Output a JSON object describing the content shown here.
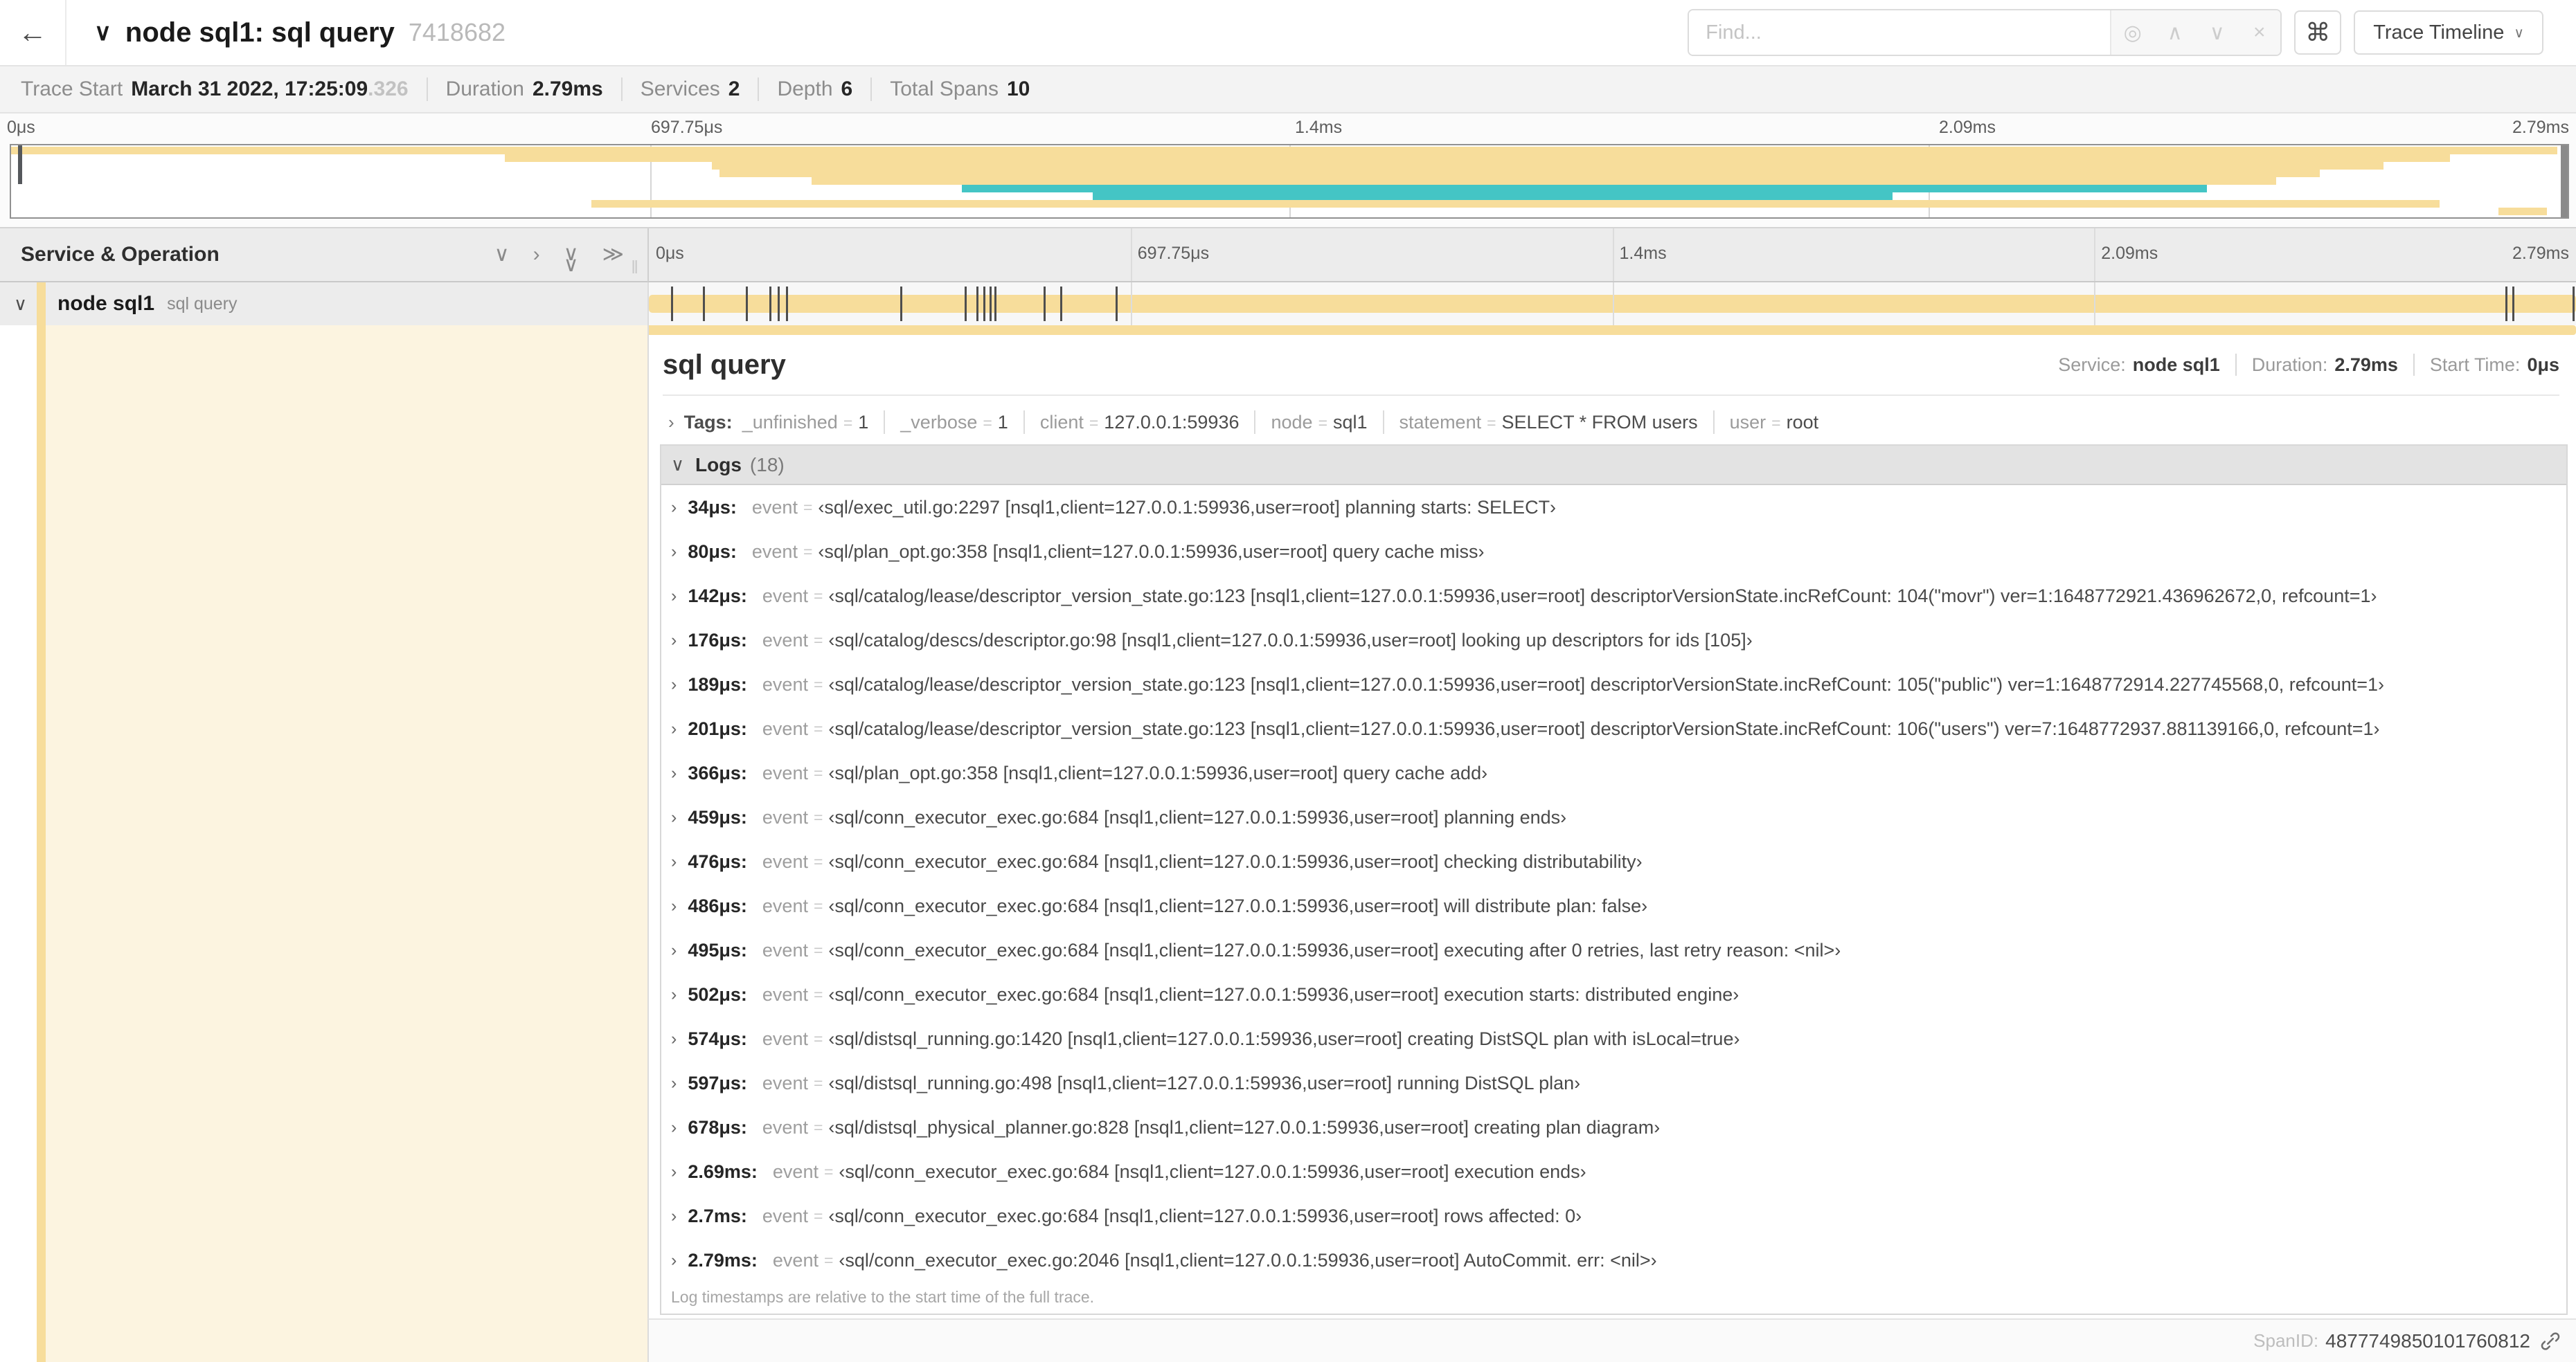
{
  "header": {
    "back_icon": "←",
    "collapse_icon": "∨",
    "title": "node sql1: sql query",
    "trace_id": "7418682",
    "find_placeholder": "Find...",
    "find_buttons": [
      "target-icon",
      "chevron-up-icon",
      "chevron-down-icon",
      "clear-icon"
    ],
    "shortcut_icon": "⌘",
    "view_selector": "Trace Timeline"
  },
  "summary": {
    "items": [
      {
        "label": "Trace Start",
        "value": "March 31 2022, 17:25:09",
        "suffix": ".326"
      },
      {
        "label": "Duration",
        "value": "2.79ms"
      },
      {
        "label": "Services",
        "value": "2"
      },
      {
        "label": "Depth",
        "value": "6"
      },
      {
        "label": "Total Spans",
        "value": "10"
      }
    ]
  },
  "time_ticks": [
    "0μs",
    "697.75μs",
    "1.4ms",
    "2.09ms",
    "2.79ms"
  ],
  "minimap": {
    "rows": [
      {
        "color": "#F7DD9B",
        "start": 0,
        "end": 99.6
      },
      {
        "color": "#F7DD9B",
        "start": 19.3,
        "end": 95.4
      },
      {
        "color": "#F7DD9B",
        "start": 27.4,
        "end": 92.8
      },
      {
        "color": "#F7DD9B",
        "start": 27.7,
        "end": 90.3
      },
      {
        "color": "#F7DD9B",
        "start": 31.3,
        "end": 88.6
      },
      {
        "color": "#44C5C5",
        "start": 37.2,
        "end": 85.9
      },
      {
        "color": "#44C5C5",
        "start": 42.3,
        "end": 73.6
      },
      {
        "color": "#F7DD9B",
        "start": 22.7,
        "end": 95.0
      },
      {
        "color": "#F7DD9B",
        "start": 97.3,
        "end": 99.2
      }
    ]
  },
  "colors": {
    "span": "#F7DD9B",
    "span_alt": "#44C5C5"
  },
  "grid": {
    "left_title": "Service & Operation"
  },
  "span_row": {
    "expand_icon": "∨",
    "service": "node sql1",
    "operation": "sql query"
  },
  "detail": {
    "title": "sql query",
    "meta": [
      {
        "label": "Service:",
        "value": "node sql1"
      },
      {
        "label": "Duration:",
        "value": "2.79ms"
      },
      {
        "label": "Start Time:",
        "value": "0μs"
      }
    ],
    "tags": {
      "label": "Tags:",
      "items": [
        {
          "key": "_unfinished",
          "value": "1"
        },
        {
          "key": "_verbose",
          "value": "1"
        },
        {
          "key": "client",
          "value": "127.0.0.1:59936"
        },
        {
          "key": "node",
          "value": "sql1"
        },
        {
          "key": "statement",
          "value": "SELECT * FROM users"
        },
        {
          "key": "user",
          "value": "root"
        }
      ]
    },
    "logs": {
      "title": "Logs",
      "count": "(18)",
      "field": "event",
      "entries": [
        {
          "time": "34μs:",
          "pct": 1.22,
          "value": "‹sql/exec_util.go:2297 [nsql1,client=127.0.0.1:59936,user=root] planning starts: SELECT›"
        },
        {
          "time": "80μs:",
          "pct": 2.87,
          "value": "‹sql/plan_opt.go:358 [nsql1,client=127.0.0.1:59936,user=root] query cache miss›"
        },
        {
          "time": "142μs:",
          "pct": 5.09,
          "value": "‹sql/catalog/lease/descriptor_version_state.go:123 [nsql1,client=127.0.0.1:59936,user=root] descriptorVersionState.incRefCount: 104(\"movr\") ver=1:1648772921.436962672,0, refcount=1›"
        },
        {
          "time": "176μs:",
          "pct": 6.31,
          "value": "‹sql/catalog/descs/descriptor.go:98 [nsql1,client=127.0.0.1:59936,user=root] looking up descriptors for ids [105]›"
        },
        {
          "time": "189μs:",
          "pct": 6.77,
          "value": "‹sql/catalog/lease/descriptor_version_state.go:123 [nsql1,client=127.0.0.1:59936,user=root] descriptorVersionState.incRefCount: 105(\"public\") ver=1:1648772914.227745568,0, refcount=1›"
        },
        {
          "time": "201μs:",
          "pct": 7.2,
          "value": "‹sql/catalog/lease/descriptor_version_state.go:123 [nsql1,client=127.0.0.1:59936,user=root] descriptorVersionState.incRefCount: 106(\"users\") ver=7:1648772937.881139166,0, refcount=1›"
        },
        {
          "time": "366μs:",
          "pct": 13.12,
          "value": "‹sql/plan_opt.go:358 [nsql1,client=127.0.0.1:59936,user=root] query cache add›"
        },
        {
          "time": "459μs:",
          "pct": 16.45,
          "value": "‹sql/conn_executor_exec.go:684 [nsql1,client=127.0.0.1:59936,user=root] planning ends›"
        },
        {
          "time": "476μs:",
          "pct": 17.06,
          "value": "‹sql/conn_executor_exec.go:684 [nsql1,client=127.0.0.1:59936,user=root] checking distributability›"
        },
        {
          "time": "486μs:",
          "pct": 17.42,
          "value": "‹sql/conn_executor_exec.go:684 [nsql1,client=127.0.0.1:59936,user=root] will distribute plan: false›"
        },
        {
          "time": "495μs:",
          "pct": 17.74,
          "value": "‹sql/conn_executor_exec.go:684 [nsql1,client=127.0.0.1:59936,user=root] executing after 0 retries, last retry reason: <nil>›"
        },
        {
          "time": "502μs:",
          "pct": 17.99,
          "value": "‹sql/conn_executor_exec.go:684 [nsql1,client=127.0.0.1:59936,user=root] execution starts: distributed engine›"
        },
        {
          "time": "574μs:",
          "pct": 20.57,
          "value": "‹sql/distsql_running.go:1420 [nsql1,client=127.0.0.1:59936,user=root] creating DistSQL plan with isLocal=true›"
        },
        {
          "time": "597μs:",
          "pct": 21.4,
          "value": "‹sql/distsql_running.go:498 [nsql1,client=127.0.0.1:59936,user=root] running DistSQL plan›"
        },
        {
          "time": "678μs:",
          "pct": 24.3,
          "value": "‹sql/distsql_physical_planner.go:828 [nsql1,client=127.0.0.1:59936,user=root] creating plan diagram›"
        },
        {
          "time": "2.69ms:",
          "pct": 96.42,
          "value": "‹sql/conn_executor_exec.go:684 [nsql1,client=127.0.0.1:59936,user=root] execution ends›"
        },
        {
          "time": "2.7ms:",
          "pct": 96.77,
          "value": "‹sql/conn_executor_exec.go:684 [nsql1,client=127.0.0.1:59936,user=root] rows affected: 0›"
        },
        {
          "time": "2.79ms:",
          "pct": 99.9,
          "value": "‹sql/conn_executor_exec.go:2046 [nsql1,client=127.0.0.1:59936,user=root] AutoCommit. err: <nil>›"
        }
      ],
      "note": "Log timestamps are relative to the start time of the full trace."
    },
    "footer": {
      "label": "SpanID:",
      "value": "4877749850101760812"
    }
  }
}
